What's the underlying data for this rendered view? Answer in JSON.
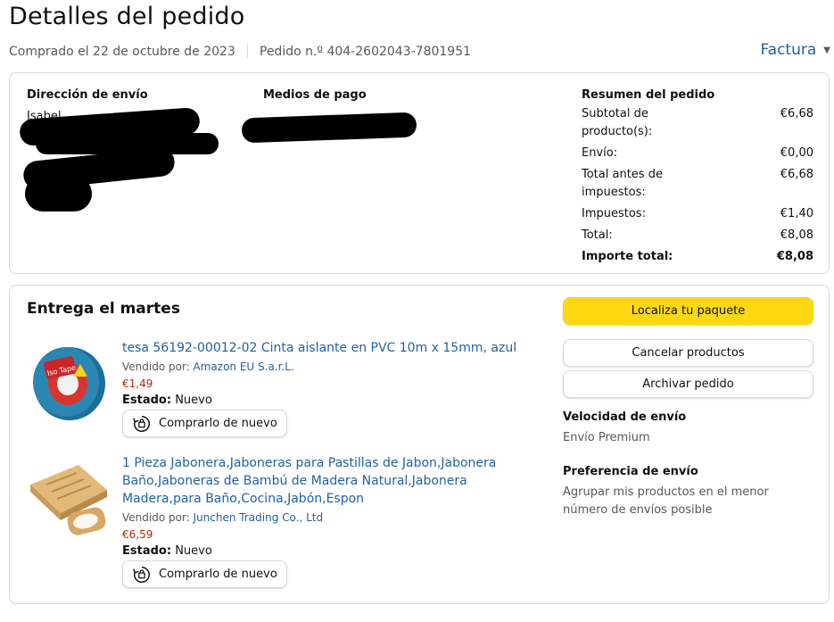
{
  "page": {
    "title": "Detalles del pedido",
    "purchase_date": "Comprado el 22 de octubre de 2023",
    "order_number": "Pedido n.º 404-2602043-7801951",
    "invoice_label": "Factura"
  },
  "shipping": {
    "heading": "Dirección de envío",
    "visible_text": "Isabel"
  },
  "payment": {
    "heading": "Medios de pago"
  },
  "summary": {
    "heading": "Resumen del pedido",
    "rows": [
      {
        "label": "Subtotal de producto(s):",
        "value": "€6,68"
      },
      {
        "label": "Envío:",
        "value": "€0,00"
      },
      {
        "label": "Total antes de impuestos:",
        "value": "€6,68"
      },
      {
        "label": "Impuestos:",
        "value": "€1,40"
      },
      {
        "label": "Total:",
        "value": "€8,08"
      }
    ],
    "grand_total": {
      "label": "Importe total:",
      "value": "€8,08"
    }
  },
  "delivery": {
    "title": "Entrega el martes",
    "items": [
      {
        "title": "tesa 56192-00012-02 Cinta aislante en PVC 10m x 15mm, azul",
        "seller_prefix": "Vendido por: ",
        "seller": "Amazon EU S.a.r.L.",
        "price": "€1,49",
        "condition_label": "Estado:",
        "condition": "Nuevo",
        "buy_again": "Comprarlo de nuevo"
      },
      {
        "title": "1 Pieza Jabonera,Jaboneras para Pastillas de Jabon,Jabonera Baño,Jaboneras de Bambú de Madera Natural,Jabonera Madera,para Baño,Cocina,Jabón,Espon",
        "seller_prefix": "Vendido por: ",
        "seller": "Junchen Trading Co., Ltd",
        "price": "€6,59",
        "condition_label": "Estado:",
        "condition": "Nuevo",
        "buy_again": "Comprarlo de nuevo"
      }
    ]
  },
  "actions": {
    "track": "Localiza tu paquete",
    "cancel": "Cancelar productos",
    "archive": "Archivar pedido",
    "speed_heading": "Velocidad de envío",
    "speed_value": "Envío Premium",
    "pref_heading": "Preferencia de envío",
    "pref_value": "Agrupar mis productos en el menor número de envíos posible"
  },
  "colors": {
    "link": "#2162a1",
    "price": "#b12704",
    "primary_button": "#ffd814",
    "border": "#d5d9d9"
  },
  "icons": [
    "chevron-down-icon",
    "buy-again-icon",
    "tape-product-image",
    "soap-dish-product-image"
  ]
}
